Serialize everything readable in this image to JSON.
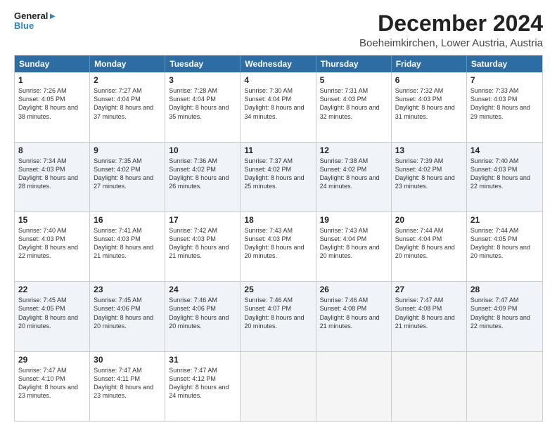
{
  "logo": {
    "line1": "General",
    "line2": "Blue"
  },
  "title": "December 2024",
  "subtitle": "Boeheimkirchen, Lower Austria, Austria",
  "days": [
    "Sunday",
    "Monday",
    "Tuesday",
    "Wednesday",
    "Thursday",
    "Friday",
    "Saturday"
  ],
  "weeks": [
    [
      {
        "day": "1",
        "sunrise": "7:26 AM",
        "sunset": "4:05 PM",
        "daylight": "8 hours and 38 minutes."
      },
      {
        "day": "2",
        "sunrise": "7:27 AM",
        "sunset": "4:04 PM",
        "daylight": "8 hours and 37 minutes."
      },
      {
        "day": "3",
        "sunrise": "7:28 AM",
        "sunset": "4:04 PM",
        "daylight": "8 hours and 35 minutes."
      },
      {
        "day": "4",
        "sunrise": "7:30 AM",
        "sunset": "4:04 PM",
        "daylight": "8 hours and 34 minutes."
      },
      {
        "day": "5",
        "sunrise": "7:31 AM",
        "sunset": "4:03 PM",
        "daylight": "8 hours and 32 minutes."
      },
      {
        "day": "6",
        "sunrise": "7:32 AM",
        "sunset": "4:03 PM",
        "daylight": "8 hours and 31 minutes."
      },
      {
        "day": "7",
        "sunrise": "7:33 AM",
        "sunset": "4:03 PM",
        "daylight": "8 hours and 29 minutes."
      }
    ],
    [
      {
        "day": "8",
        "sunrise": "7:34 AM",
        "sunset": "4:03 PM",
        "daylight": "8 hours and 28 minutes."
      },
      {
        "day": "9",
        "sunrise": "7:35 AM",
        "sunset": "4:02 PM",
        "daylight": "8 hours and 27 minutes."
      },
      {
        "day": "10",
        "sunrise": "7:36 AM",
        "sunset": "4:02 PM",
        "daylight": "8 hours and 26 minutes."
      },
      {
        "day": "11",
        "sunrise": "7:37 AM",
        "sunset": "4:02 PM",
        "daylight": "8 hours and 25 minutes."
      },
      {
        "day": "12",
        "sunrise": "7:38 AM",
        "sunset": "4:02 PM",
        "daylight": "8 hours and 24 minutes."
      },
      {
        "day": "13",
        "sunrise": "7:39 AM",
        "sunset": "4:02 PM",
        "daylight": "8 hours and 23 minutes."
      },
      {
        "day": "14",
        "sunrise": "7:40 AM",
        "sunset": "4:03 PM",
        "daylight": "8 hours and 22 minutes."
      }
    ],
    [
      {
        "day": "15",
        "sunrise": "7:40 AM",
        "sunset": "4:03 PM",
        "daylight": "8 hours and 22 minutes."
      },
      {
        "day": "16",
        "sunrise": "7:41 AM",
        "sunset": "4:03 PM",
        "daylight": "8 hours and 21 minutes."
      },
      {
        "day": "17",
        "sunrise": "7:42 AM",
        "sunset": "4:03 PM",
        "daylight": "8 hours and 21 minutes."
      },
      {
        "day": "18",
        "sunrise": "7:43 AM",
        "sunset": "4:03 PM",
        "daylight": "8 hours and 20 minutes."
      },
      {
        "day": "19",
        "sunrise": "7:43 AM",
        "sunset": "4:04 PM",
        "daylight": "8 hours and 20 minutes."
      },
      {
        "day": "20",
        "sunrise": "7:44 AM",
        "sunset": "4:04 PM",
        "daylight": "8 hours and 20 minutes."
      },
      {
        "day": "21",
        "sunrise": "7:44 AM",
        "sunset": "4:05 PM",
        "daylight": "8 hours and 20 minutes."
      }
    ],
    [
      {
        "day": "22",
        "sunrise": "7:45 AM",
        "sunset": "4:05 PM",
        "daylight": "8 hours and 20 minutes."
      },
      {
        "day": "23",
        "sunrise": "7:45 AM",
        "sunset": "4:06 PM",
        "daylight": "8 hours and 20 minutes."
      },
      {
        "day": "24",
        "sunrise": "7:46 AM",
        "sunset": "4:06 PM",
        "daylight": "8 hours and 20 minutes."
      },
      {
        "day": "25",
        "sunrise": "7:46 AM",
        "sunset": "4:07 PM",
        "daylight": "8 hours and 20 minutes."
      },
      {
        "day": "26",
        "sunrise": "7:46 AM",
        "sunset": "4:08 PM",
        "daylight": "8 hours and 21 minutes."
      },
      {
        "day": "27",
        "sunrise": "7:47 AM",
        "sunset": "4:08 PM",
        "daylight": "8 hours and 21 minutes."
      },
      {
        "day": "28",
        "sunrise": "7:47 AM",
        "sunset": "4:09 PM",
        "daylight": "8 hours and 22 minutes."
      }
    ],
    [
      {
        "day": "29",
        "sunrise": "7:47 AM",
        "sunset": "4:10 PM",
        "daylight": "8 hours and 23 minutes."
      },
      {
        "day": "30",
        "sunrise": "7:47 AM",
        "sunset": "4:11 PM",
        "daylight": "8 hours and 23 minutes."
      },
      {
        "day": "31",
        "sunrise": "7:47 AM",
        "sunset": "4:12 PM",
        "daylight": "8 hours and 24 minutes."
      },
      null,
      null,
      null,
      null
    ]
  ]
}
